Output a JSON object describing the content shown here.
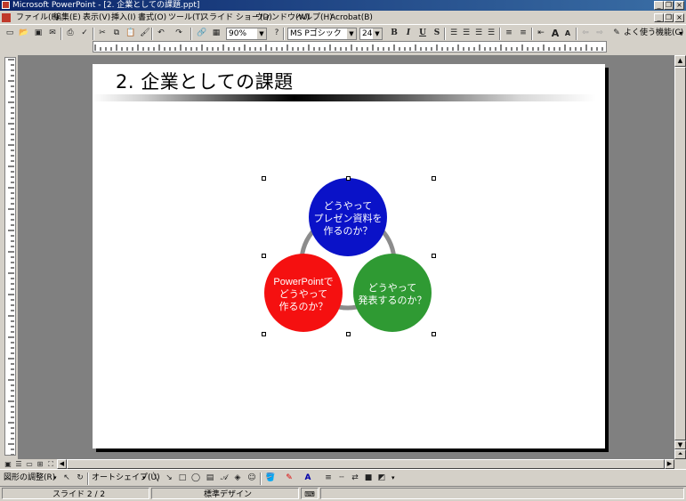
{
  "window": {
    "title": "Microsoft PowerPoint - [2. 企業としての課題.ppt]"
  },
  "menu": [
    "ファイル(F)",
    "編集(E)",
    "表示(V)",
    "挿入(I)",
    "書式(O)",
    "ツール(T)",
    "スライド ショー(D)",
    "ウィンドウ(W)",
    "ヘルプ(H)",
    "Acrobat(B)"
  ],
  "toolbar": {
    "zoom": "90%",
    "font_name": "MS Pゴシック",
    "font_size": "24",
    "bold": "B",
    "italic": "I",
    "underline": "U",
    "shadow": "S",
    "grow_font": "A",
    "shrink_font": "A",
    "help_label": "よく使う機能(C)"
  },
  "slide": {
    "title": "2. 企業としての課題",
    "circles": {
      "top": [
        "どうやって",
        "プレゼン資料を",
        "作るのか？"
      ],
      "left": [
        "PowerPointで",
        "どうやって",
        "作るのか？"
      ],
      "right": [
        "どうやって",
        "発表するのか？"
      ]
    }
  },
  "drawing_toolbar": {
    "draw_menu": "図形の調整(R)",
    "autoshapes": "オートシェイプ(U)"
  },
  "status": {
    "slide": "スライド 2 / 2",
    "design": "標準デザイン"
  },
  "colors": {
    "blue": "#0a12c8",
    "red": "#f51010",
    "green": "#2f9a33",
    "ring": "#8c8c8c",
    "titlebar": "#0a246a"
  }
}
